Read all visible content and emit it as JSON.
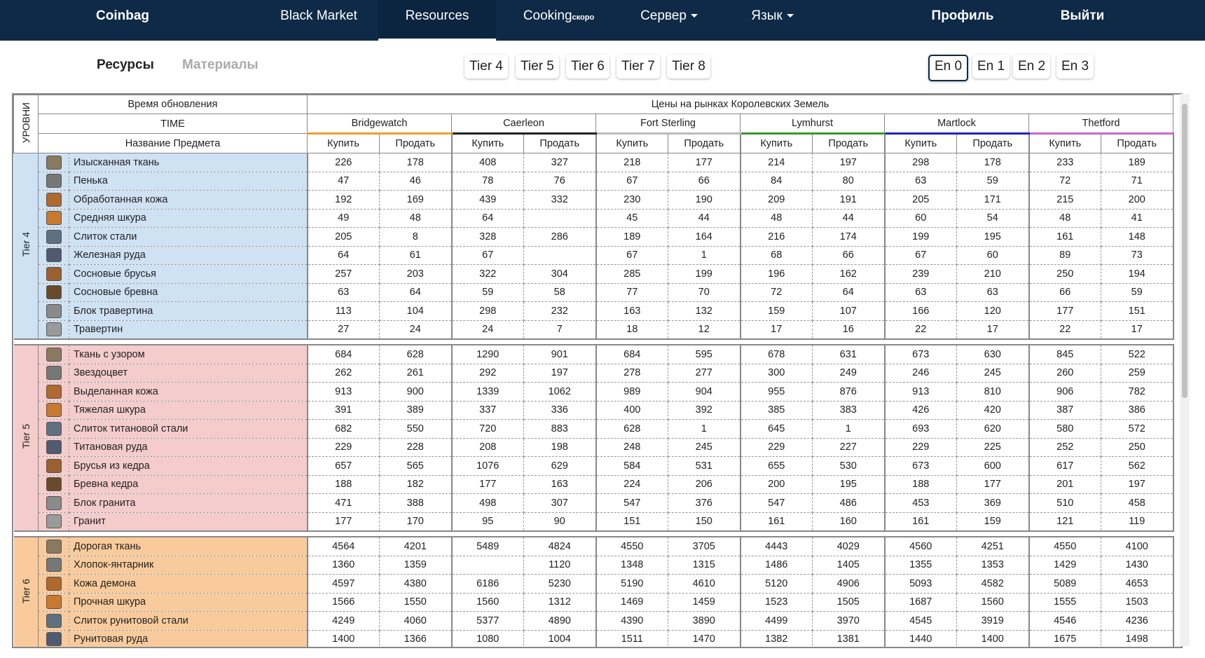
{
  "nav": {
    "brand": "Coinbag",
    "items": [
      "Black Market",
      "Resources",
      "Cooking",
      "Сервер",
      "Язык"
    ],
    "cooking_badge": "скоро",
    "profile": "Профиль",
    "logout": "Выйти"
  },
  "subtabs": [
    "Ресурсы",
    "Материалы"
  ],
  "tiers": [
    "Tier 4",
    "Tier 5",
    "Tier 6",
    "Tier 7",
    "Tier 8"
  ],
  "enchants": [
    "En 0",
    "En 1",
    "En 2",
    "En 3"
  ],
  "colors": {
    "nav_bg": "#0e2a47",
    "tier4": "#cfe2f3",
    "tier5": "#f4cccc",
    "tier6": "#f9cb9c"
  },
  "table": {
    "levels_label": "УРОВНИ",
    "update_time_label": "Время обновления",
    "markets_label": "Цены на рынках Королевских Земель",
    "time_label": "TIME",
    "item_name_label": "Название Предмета",
    "buy_label": "Купить",
    "sell_label": "Продать",
    "cities": [
      {
        "name": "Bridgewatch",
        "color": "#f0a030"
      },
      {
        "name": "Caerleon",
        "color": "#222222"
      },
      {
        "name": "Fort Sterling",
        "color": "#bbbbbb"
      },
      {
        "name": "Lymhurst",
        "color": "#3a9a2a"
      },
      {
        "name": "Martlock",
        "color": "#2222cc"
      },
      {
        "name": "Thetford",
        "color": "#cc66cc"
      }
    ],
    "groups": [
      {
        "tier": "Tier 4",
        "color": "#cfe2f3",
        "rows": [
          {
            "name": "Изысканная ткань",
            "icon": "cloth-icon",
            "v": [
              "226",
              "178",
              "408",
              "327",
              "218",
              "177",
              "214",
              "197",
              "298",
              "178",
              "233",
              "189"
            ]
          },
          {
            "name": "Пенька",
            "icon": "fiber-icon",
            "v": [
              "47",
              "46",
              "78",
              "76",
              "67",
              "66",
              "84",
              "80",
              "63",
              "59",
              "72",
              "71"
            ]
          },
          {
            "name": "Обработанная кожа",
            "icon": "leather-icon",
            "v": [
              "192",
              "169",
              "439",
              "332",
              "230",
              "190",
              "209",
              "191",
              "205",
              "171",
              "215",
              "200"
            ]
          },
          {
            "name": "Средняя шкура",
            "icon": "hide-icon",
            "v": [
              "49",
              "48",
              "64",
              "",
              "45",
              "44",
              "48",
              "44",
              "60",
              "54",
              "48",
              "41"
            ]
          },
          {
            "name": "Слиток стали",
            "icon": "metal-bar-icon",
            "v": [
              "205",
              "8",
              "328",
              "286",
              "189",
              "164",
              "216",
              "174",
              "199",
              "195",
              "161",
              "148"
            ]
          },
          {
            "name": "Железная руда",
            "icon": "ore-icon",
            "v": [
              "64",
              "61",
              "67",
              "",
              "67",
              "1",
              "68",
              "66",
              "67",
              "60",
              "89",
              "73"
            ]
          },
          {
            "name": "Сосновые брусья",
            "icon": "planks-icon",
            "v": [
              "257",
              "203",
              "322",
              "304",
              "285",
              "199",
              "196",
              "162",
              "239",
              "210",
              "250",
              "194"
            ]
          },
          {
            "name": "Сосновые бревна",
            "icon": "wood-icon",
            "v": [
              "63",
              "64",
              "59",
              "58",
              "77",
              "70",
              "72",
              "64",
              "63",
              "63",
              "66",
              "59"
            ]
          },
          {
            "name": "Блок травертина",
            "icon": "stone-block-icon",
            "v": [
              "113",
              "104",
              "298",
              "232",
              "163",
              "132",
              "159",
              "107",
              "166",
              "120",
              "177",
              "151"
            ]
          },
          {
            "name": "Травертин",
            "icon": "stone-icon",
            "v": [
              "27",
              "24",
              "24",
              "7",
              "18",
              "12",
              "17",
              "16",
              "22",
              "17",
              "22",
              "17"
            ]
          }
        ]
      },
      {
        "tier": "Tier 5",
        "color": "#f4cccc",
        "rows": [
          {
            "name": "Ткань с узором",
            "icon": "cloth-icon",
            "v": [
              "684",
              "628",
              "1290",
              "901",
              "684",
              "595",
              "678",
              "631",
              "673",
              "630",
              "845",
              "522"
            ]
          },
          {
            "name": "Звездоцвет",
            "icon": "fiber-icon",
            "v": [
              "262",
              "261",
              "292",
              "197",
              "278",
              "277",
              "300",
              "249",
              "246",
              "245",
              "260",
              "259"
            ]
          },
          {
            "name": "Выделанная кожа",
            "icon": "leather-icon",
            "v": [
              "913",
              "900",
              "1339",
              "1062",
              "989",
              "904",
              "955",
              "876",
              "913",
              "810",
              "906",
              "782"
            ]
          },
          {
            "name": "Тяжелая шкура",
            "icon": "hide-icon",
            "v": [
              "391",
              "389",
              "337",
              "336",
              "400",
              "392",
              "385",
              "383",
              "426",
              "420",
              "387",
              "386"
            ]
          },
          {
            "name": "Слиток титановой стали",
            "icon": "metal-bar-icon",
            "v": [
              "682",
              "550",
              "720",
              "883",
              "628",
              "1",
              "645",
              "1",
              "693",
              "620",
              "580",
              "572"
            ]
          },
          {
            "name": "Титановая руда",
            "icon": "ore-icon",
            "v": [
              "229",
              "228",
              "208",
              "198",
              "248",
              "245",
              "229",
              "227",
              "229",
              "225",
              "252",
              "250"
            ]
          },
          {
            "name": "Брусья из кедра",
            "icon": "planks-icon",
            "v": [
              "657",
              "565",
              "1076",
              "629",
              "584",
              "531",
              "655",
              "530",
              "673",
              "600",
              "617",
              "562"
            ]
          },
          {
            "name": "Бревна кедра",
            "icon": "wood-icon",
            "v": [
              "188",
              "182",
              "177",
              "163",
              "224",
              "206",
              "200",
              "195",
              "188",
              "177",
              "201",
              "197"
            ]
          },
          {
            "name": "Блок гранита",
            "icon": "stone-block-icon",
            "v": [
              "471",
              "388",
              "498",
              "307",
              "547",
              "376",
              "547",
              "486",
              "453",
              "369",
              "510",
              "458"
            ]
          },
          {
            "name": "Гранит",
            "icon": "stone-icon",
            "v": [
              "177",
              "170",
              "95",
              "90",
              "151",
              "150",
              "161",
              "160",
              "161",
              "159",
              "121",
              "119"
            ]
          }
        ]
      },
      {
        "tier": "Tier 6",
        "color": "#f9cb9c",
        "rows": [
          {
            "name": "Дорогая ткань",
            "icon": "cloth-icon",
            "v": [
              "4564",
              "4201",
              "5489",
              "4824",
              "4550",
              "3705",
              "4443",
              "4029",
              "4560",
              "4251",
              "4550",
              "4100"
            ]
          },
          {
            "name": "Хлопок-янтарник",
            "icon": "fiber-icon",
            "v": [
              "1360",
              "1359",
              "",
              "1120",
              "1348",
              "1315",
              "1486",
              "1405",
              "1355",
              "1353",
              "1429",
              "1430"
            ]
          },
          {
            "name": "Кожа демона",
            "icon": "leather-icon",
            "v": [
              "4597",
              "4380",
              "6186",
              "5230",
              "5190",
              "4610",
              "5120",
              "4906",
              "5093",
              "4582",
              "5089",
              "4653"
            ]
          },
          {
            "name": "Прочная шкура",
            "icon": "hide-icon",
            "v": [
              "1566",
              "1550",
              "1560",
              "1312",
              "1469",
              "1459",
              "1523",
              "1505",
              "1687",
              "1560",
              "1555",
              "1503"
            ]
          },
          {
            "name": "Слиток рунитовой стали",
            "icon": "metal-bar-icon",
            "v": [
              "4249",
              "4060",
              "5377",
              "4890",
              "4390",
              "3890",
              "4499",
              "3970",
              "4545",
              "3919",
              "4546",
              "4236"
            ]
          },
          {
            "name": "Рунитовая руда",
            "icon": "ore-icon",
            "v": [
              "1400",
              "1366",
              "1080",
              "1004",
              "1511",
              "1470",
              "1382",
              "1381",
              "1440",
              "1400",
              "1675",
              "1498"
            ]
          }
        ]
      }
    ]
  }
}
